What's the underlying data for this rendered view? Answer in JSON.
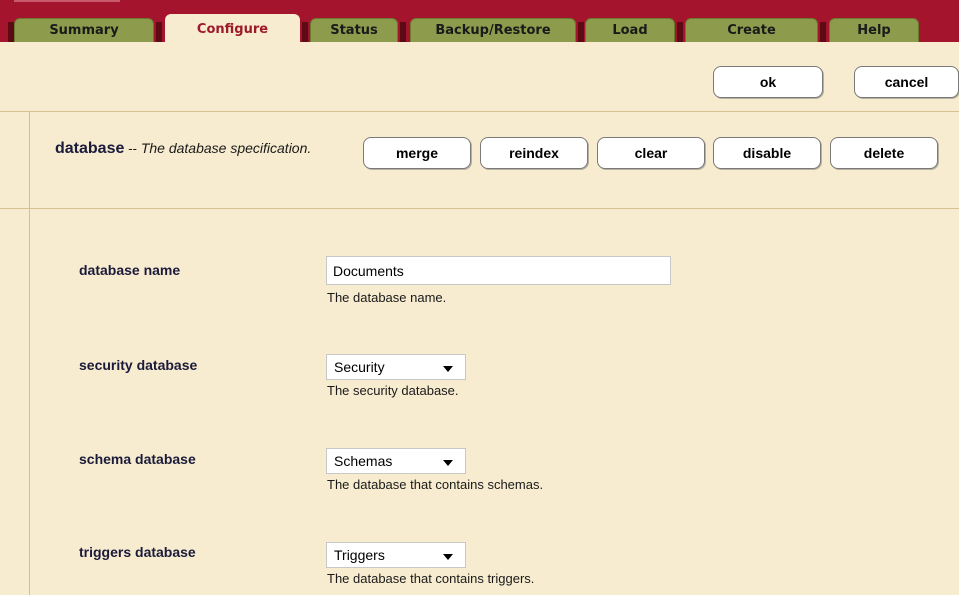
{
  "tabs": [
    {
      "label": "Summary"
    },
    {
      "label": "Configure"
    },
    {
      "label": "Status"
    },
    {
      "label": "Backup/Restore"
    },
    {
      "label": "Load"
    },
    {
      "label": "Create"
    },
    {
      "label": "Help"
    }
  ],
  "actions": {
    "ok": "ok",
    "cancel": "cancel"
  },
  "section": {
    "name": "database",
    "dash": "--",
    "description": "The database specification."
  },
  "section_buttons": {
    "merge": "merge",
    "reindex": "reindex",
    "clear": "clear",
    "disable": "disable",
    "delete": "delete"
  },
  "fields": {
    "database_name": {
      "label": "database name",
      "value": "Documents",
      "help": "The database name."
    },
    "security_database": {
      "label": "security database",
      "value": "Security",
      "help": "The security database."
    },
    "schema_database": {
      "label": "schema database",
      "value": "Schemas",
      "help": "The database that contains schemas."
    },
    "triggers_database": {
      "label": "triggers database",
      "value": "Triggers",
      "help": "The database that contains triggers."
    }
  },
  "colors": {
    "header": "#a4142c",
    "tab_inactive": "#8c9c4c",
    "background": "#f8ecd0",
    "active_tab_text": "#9c1a2c"
  }
}
